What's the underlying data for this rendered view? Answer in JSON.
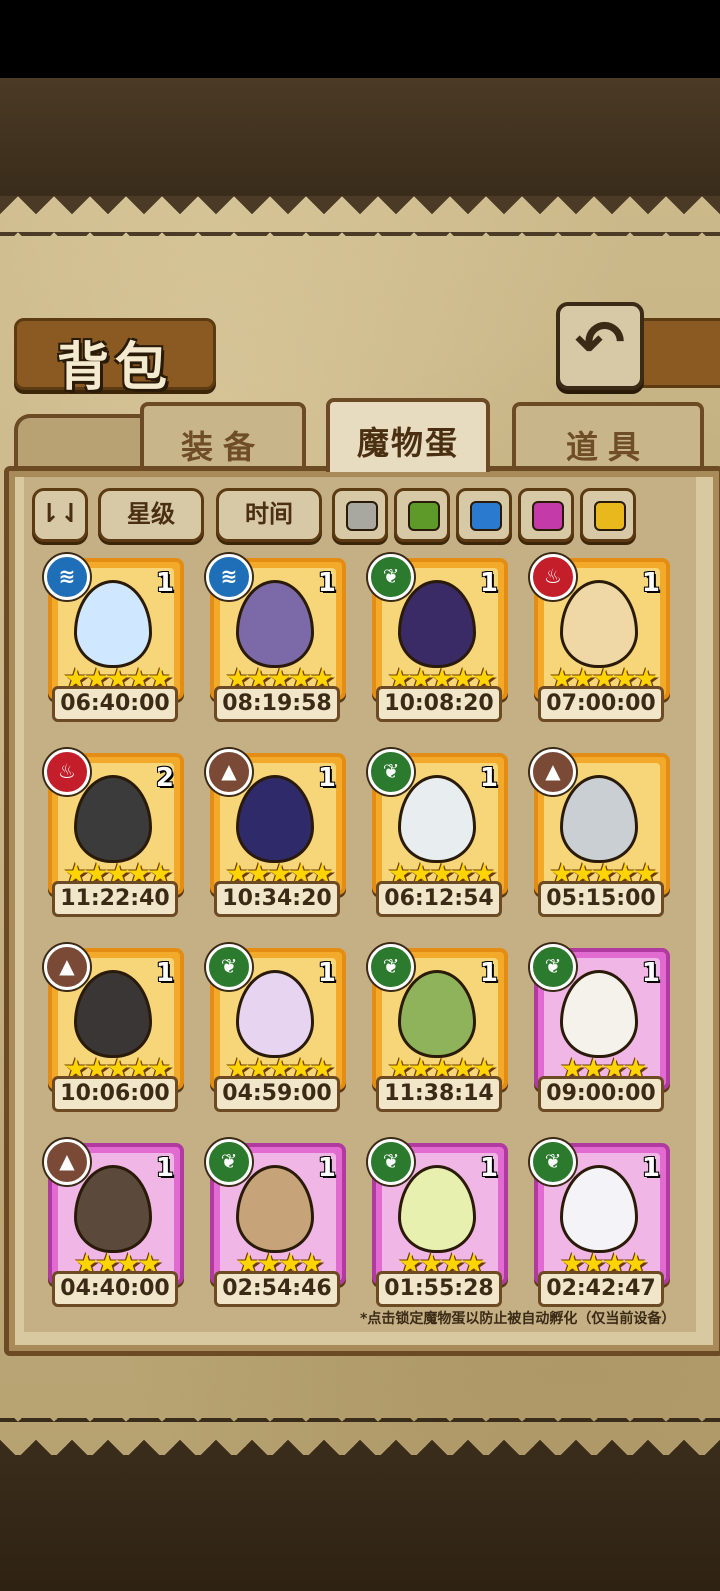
{
  "header": {
    "title": "背包",
    "back_icon": "back-arrow-icon"
  },
  "tabs": [
    {
      "label": "装备",
      "active": false
    },
    {
      "label": "魔物蛋",
      "active": true
    },
    {
      "label": "道具",
      "active": false
    }
  ],
  "filters": {
    "sort_icon": "sort-toggle-icon",
    "star_label": "星级",
    "time_label": "时间",
    "colors": [
      "#a8a8a0",
      "#5e9a2a",
      "#2a7ad0",
      "#c43aa8",
      "#e8b81c"
    ]
  },
  "eggs": [
    {
      "element": "water",
      "count": "1",
      "stars": "★★★★★",
      "timer": "06:40:00",
      "frame": "orange",
      "egg_color": "#cfe8ff"
    },
    {
      "element": "water",
      "count": "1",
      "stars": "★★★★★",
      "timer": "08:19:58",
      "frame": "orange",
      "egg_color": "#7c6aa8"
    },
    {
      "element": "leaf",
      "count": "1",
      "stars": "★★★★★",
      "timer": "10:08:20",
      "frame": "orange",
      "egg_color": "#3a2a66"
    },
    {
      "element": "fire",
      "count": "1",
      "stars": "★★★★★",
      "timer": "07:00:00",
      "frame": "orange",
      "egg_color": "#f0d7a6"
    },
    {
      "element": "fire",
      "count": "2",
      "stars": "★★★★★",
      "timer": "11:22:40",
      "frame": "orange",
      "egg_color": "#3b3b3b"
    },
    {
      "element": "earth",
      "count": "1",
      "stars": "★★★★★",
      "timer": "10:34:20",
      "frame": "orange",
      "egg_color": "#2f2a6a"
    },
    {
      "element": "leaf",
      "count": "1",
      "stars": "★★★★★",
      "timer": "06:12:54",
      "frame": "orange",
      "egg_color": "#e8eef0"
    },
    {
      "element": "earth",
      "count": "",
      "stars": "★★★★★",
      "timer": "05:15:00",
      "frame": "orange",
      "egg_color": "#c9cfd2"
    },
    {
      "element": "earth",
      "count": "1",
      "stars": "★★★★★",
      "timer": "10:06:00",
      "frame": "orange",
      "egg_color": "#3a3636"
    },
    {
      "element": "leaf",
      "count": "1",
      "stars": "★★★★★",
      "timer": "04:59:00",
      "frame": "orange",
      "egg_color": "#e6d4f0"
    },
    {
      "element": "leaf",
      "count": "1",
      "stars": "★★★★★",
      "timer": "11:38:14",
      "frame": "orange",
      "egg_color": "#8fb35a"
    },
    {
      "element": "leaf",
      "count": "1",
      "stars": "★★★★",
      "timer": "09:00:00",
      "frame": "purple",
      "egg_color": "#f4f2ea"
    },
    {
      "element": "earth",
      "count": "1",
      "stars": "★★★★",
      "timer": "04:40:00",
      "frame": "purple",
      "egg_color": "#5b4a3c"
    },
    {
      "element": "leaf",
      "count": "1",
      "stars": "★★★★",
      "timer": "02:54:46",
      "frame": "purple",
      "egg_color": "#c7a37a"
    },
    {
      "element": "leaf",
      "count": "1",
      "stars": "★★★★",
      "timer": "01:55:28",
      "frame": "purple",
      "egg_color": "#e8f0b0"
    },
    {
      "element": "leaf",
      "count": "1",
      "stars": "★★★★",
      "timer": "02:42:47",
      "frame": "purple",
      "egg_color": "#f4f4f8"
    }
  ],
  "element_glyphs": {
    "water": "≋",
    "leaf": "❦",
    "fire": "♨",
    "earth": "▲"
  },
  "footer_note": "*点击锁定魔物蛋以防止被自动孵化（仅当前设备）"
}
